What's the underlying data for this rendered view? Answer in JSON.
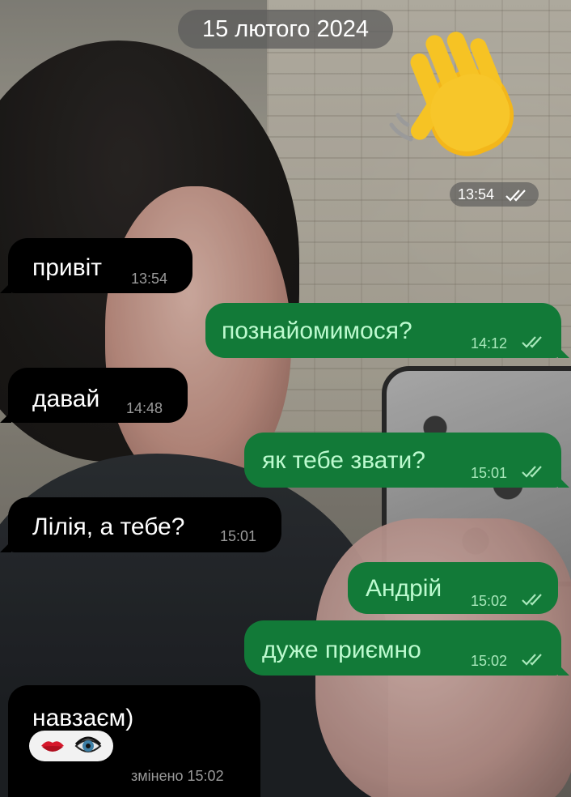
{
  "date_separator": "15 лютого 2024",
  "sticker": {
    "name": "waving-hand-sticker",
    "time": "13:54",
    "status": "read-double-check"
  },
  "messages": [
    {
      "direction": "in",
      "text": "привіт",
      "time": "13:54"
    },
    {
      "direction": "out",
      "text": "познайомимося?",
      "time": "14:12",
      "status": "read-double-check"
    },
    {
      "direction": "in",
      "text": "давай",
      "time": "14:48"
    },
    {
      "direction": "out",
      "text": "як тебе звати?",
      "time": "15:01",
      "status": "read-double-check"
    },
    {
      "direction": "in",
      "text": "Лілія, а тебе?",
      "time": "15:01"
    },
    {
      "direction": "out",
      "text": "Андрій",
      "time": "15:02",
      "status": "read-double-check"
    },
    {
      "direction": "out",
      "text": "дуже приємно",
      "time": "15:02",
      "status": "read-double-check"
    },
    {
      "direction": "in",
      "text": "навзаєм)",
      "time": "змінено 15:02",
      "reactions": [
        "kiss-mark",
        "eye"
      ]
    }
  ],
  "colors": {
    "incoming_bubble": "#000000",
    "outgoing_bubble": "#127a38",
    "outgoing_text": "#bdfacf",
    "incoming_text": "#ffffff"
  }
}
